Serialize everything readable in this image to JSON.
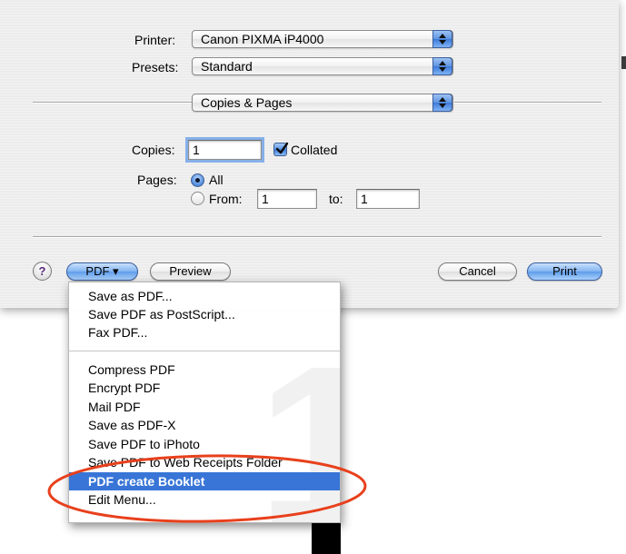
{
  "dialog": {
    "printer_label": "Printer:",
    "printer_value": "Canon PIXMA iP4000",
    "presets_label": "Presets:",
    "presets_value": "Standard",
    "panel_value": "Copies & Pages",
    "copies_label": "Copies:",
    "copies_value": "1",
    "collated_label": "Collated",
    "collated_checked": true,
    "pages_label": "Pages:",
    "all_label": "All",
    "all_selected": true,
    "from_label": "From:",
    "from_value": "1",
    "to_label": "to:",
    "to_value": "1"
  },
  "buttons": {
    "help": "?",
    "pdf": "PDF ▾",
    "preview": "Preview",
    "cancel": "Cancel",
    "print": "Print"
  },
  "pdf_menu": {
    "items_group1": [
      "Save as PDF...",
      "Save PDF as PostScript...",
      "Fax PDF..."
    ],
    "items_group2": [
      "Compress PDF",
      "Encrypt PDF",
      "Mail PDF",
      "Save as PDF-X",
      "Save PDF to iPhoto",
      "Save PDF to Web Receipts Folder",
      "PDF create Booklet",
      "Edit Menu..."
    ],
    "selected_item": "PDF create Booklet"
  },
  "colors": {
    "highlight_ellipse": "#e8401c",
    "menu_selection": "#3875d7",
    "aqua_blue": "#5f95e0"
  }
}
